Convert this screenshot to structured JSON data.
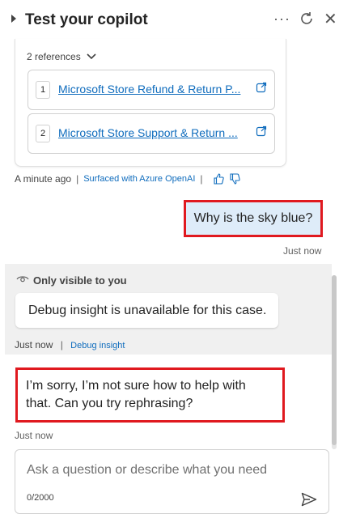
{
  "header": {
    "title": "Test your copilot",
    "more_icon": "more-horizontal-icon",
    "refresh_icon": "refresh-icon",
    "close_icon": "close-icon"
  },
  "references": {
    "toggle_label": "2 references",
    "items": [
      {
        "number": "1",
        "title": "Microsoft Store Refund & Return P..."
      },
      {
        "number": "2",
        "title": "Microsoft Store Support & Return ..."
      }
    ]
  },
  "response_meta": {
    "time": "A minute ago",
    "source": "Surfaced with Azure OpenAI"
  },
  "user_message": {
    "text": "Why is the sky blue?",
    "time": "Just now"
  },
  "debug": {
    "visibility": "Only visible to you",
    "message": "Debug insight is unavailable for this case.",
    "time": "Just now",
    "link": "Debug insight"
  },
  "bot_message": {
    "line1": "I’m sorry, I’m not sure how to help with",
    "line2": "that. Can you try rephrasing?",
    "time": "Just now"
  },
  "composer": {
    "placeholder": "Ask a question or describe what you need",
    "value": "",
    "char_count": "0/2000"
  },
  "colors": {
    "accent_link": "#0f6cbd",
    "user_bubble": "#deecf9",
    "highlight_border": "#e0191f"
  }
}
